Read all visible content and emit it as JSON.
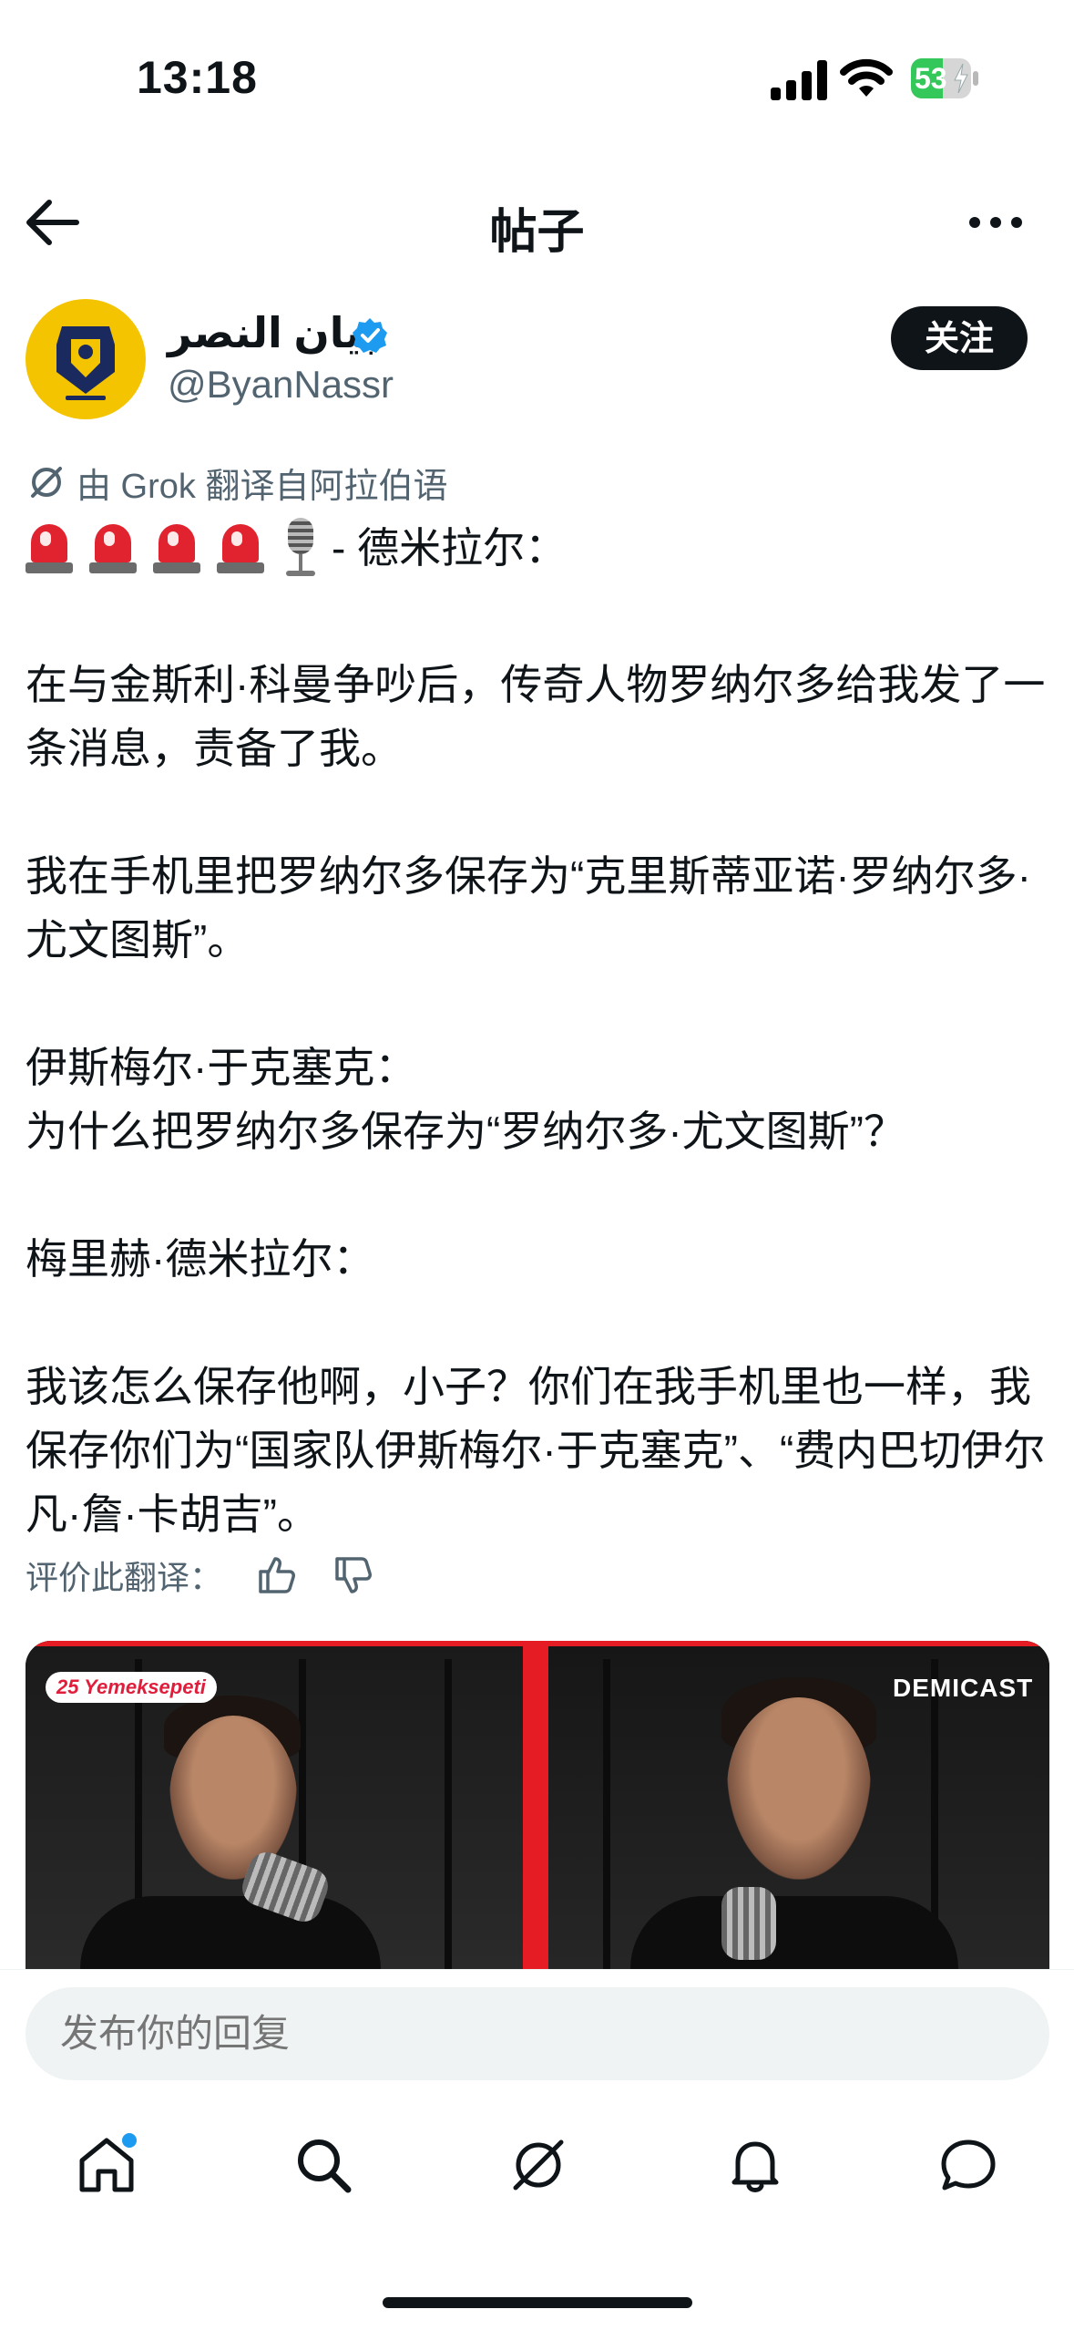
{
  "status_bar": {
    "time": "13:18",
    "battery": "53",
    "battery_level": 0.53
  },
  "header": {
    "title": "帖子"
  },
  "author": {
    "name": "بيان النصر",
    "handle": "@ByanNassr",
    "follow_label": "关注"
  },
  "translation_note": "由 Grok 翻译自阿拉伯语",
  "post": {
    "emoji_line_suffix": "- 德米拉尔：",
    "paragraphs": [
      "在与金斯利·科曼争吵后，传奇人物罗纳尔多给我发了一条消息，责备了我。",
      "我在手机里把罗纳尔多保存为“克里斯蒂亚诺·罗纳尔多·尤文图斯”。",
      "伊斯梅尔·于克塞克：\n为什么把罗纳尔多保存为“罗纳尔多·尤文图斯”？",
      "梅里赫·德米拉尔：",
      "我该怎么保存他啊，小子？你们在我手机里也一样，我保存你们为“国家队伊斯梅尔·于克塞克”、“费内巴切伊尔凡·詹·卡胡吉”。"
    ]
  },
  "rate_translation_label": "评价此翻译：",
  "media": {
    "sponsor_badge": "25 Yemeksepeti",
    "watermark": "DEMICAST"
  },
  "reply": {
    "placeholder": "发布你的回复"
  },
  "icons": {
    "back": "arrow-left-icon",
    "more": "more-horizontal-icon",
    "verified": "verified-badge-icon",
    "grok": "grok-icon",
    "thumbs_up": "thumbs-up-icon",
    "thumbs_down": "thumbs-down-icon",
    "nav": [
      "home-icon",
      "search-icon",
      "grok-icon",
      "bell-icon",
      "chat-icon"
    ]
  },
  "colors": {
    "accent": "#1d9bf0",
    "text": "#0f1419",
    "muted": "#536471",
    "avatar_bg": "#f5c400",
    "video_red": "#e51c23"
  }
}
